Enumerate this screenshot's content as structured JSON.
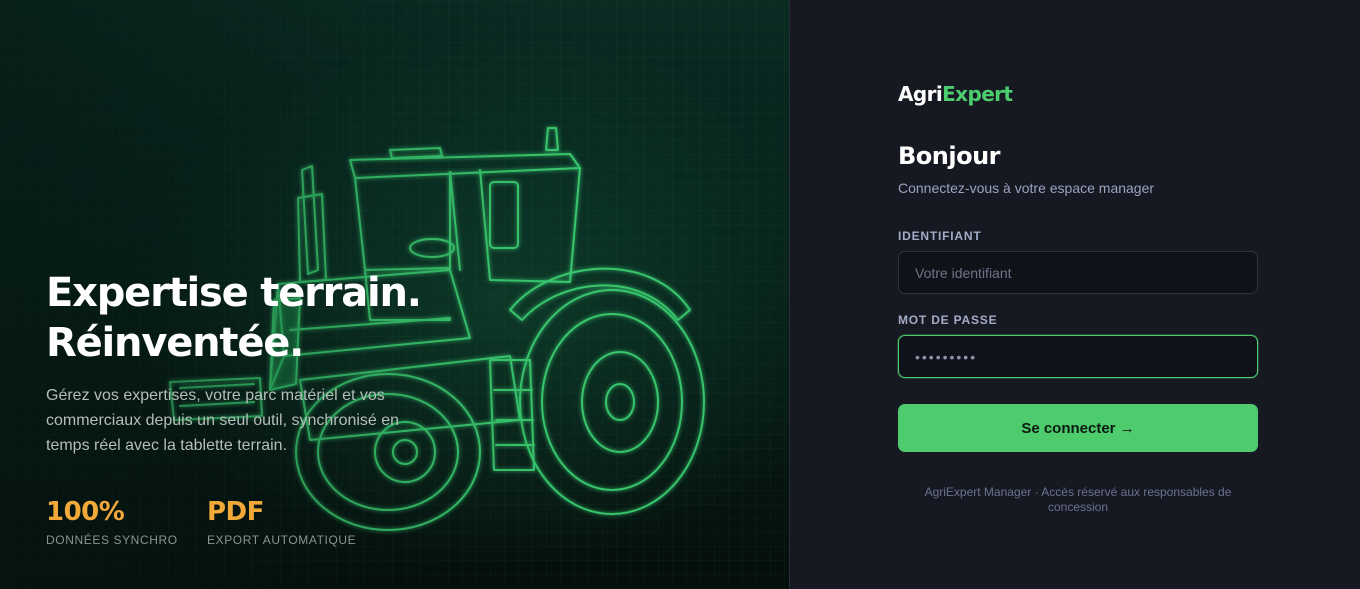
{
  "hero": {
    "title_line1": "Expertise terrain.",
    "title_line2": "Réinventée.",
    "description": "Gérez vos expertises, votre parc matériel et vos commerciaux depuis un seul outil, synchronisé en temps réel avec la tablette terrain.",
    "stats": [
      {
        "value": "100%",
        "label": "DONNÉES SYNCHRO"
      },
      {
        "value": "PDF",
        "label": "EXPORT AUTOMATIQUE"
      }
    ],
    "illustration_icon": "tractor-wireframe-icon"
  },
  "login": {
    "brand_part1": "Agri",
    "brand_part2": "Expert",
    "greeting": "Bonjour",
    "subtitle": "Connectez-vous à votre espace manager",
    "username_label": "IDENTIFIANT",
    "username_placeholder": "Votre identifiant",
    "username_value": "",
    "password_label": "MOT DE PASSE",
    "password_value": "•••••••••",
    "submit_label": "Se connecter →",
    "footer": "AgriExpert Manager · Accès réservé aux responsables de concession"
  },
  "colors": {
    "accent_green": "#4ecb6c",
    "stat_orange": "#f2a93a",
    "panel_bg": "#171922",
    "hero_bg": "#06201a"
  }
}
